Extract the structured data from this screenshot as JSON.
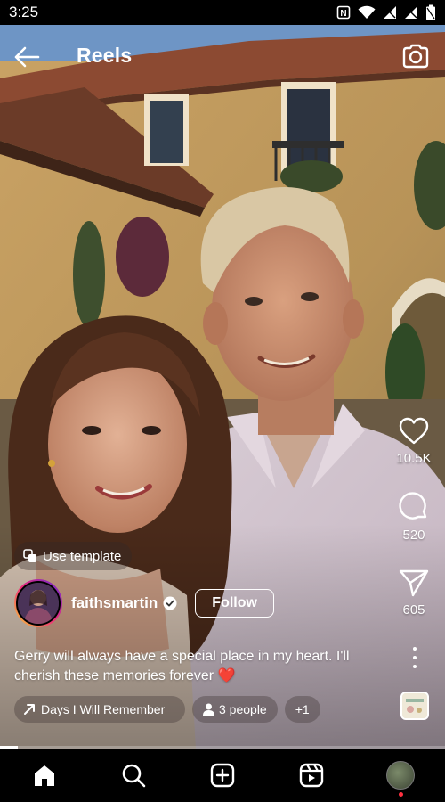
{
  "status_bar": {
    "time": "3:25"
  },
  "header": {
    "title": "Reels"
  },
  "actions": {
    "like_count": "10.5K",
    "comment_count": "520",
    "share_count": "605"
  },
  "template_chip": {
    "label": "Use template"
  },
  "user": {
    "username": "faithsmartin",
    "verified": true,
    "follow_label": "Follow"
  },
  "caption": {
    "text": "Gerry will always have a special place in my heart. I'll cherish these memories forever",
    "emoji": "❤️"
  },
  "chips": {
    "audio": "Days I Will Remember",
    "people": "3 people",
    "more": "+1"
  },
  "progress": {
    "fraction": 0.04
  },
  "colors": {
    "background": "#000000",
    "accent_red": "#e0241c",
    "text": "#ffffff",
    "notification_dot": "#ff3040"
  },
  "icons": {
    "back": "arrow-left-icon",
    "camera": "camera-icon",
    "like": "heart-icon",
    "comment": "comment-bubble-icon",
    "share": "paper-plane-icon",
    "more": "more-vertical-icon",
    "home": "home-icon",
    "search": "search-icon",
    "create": "plus-square-icon",
    "reels": "reels-icon"
  }
}
